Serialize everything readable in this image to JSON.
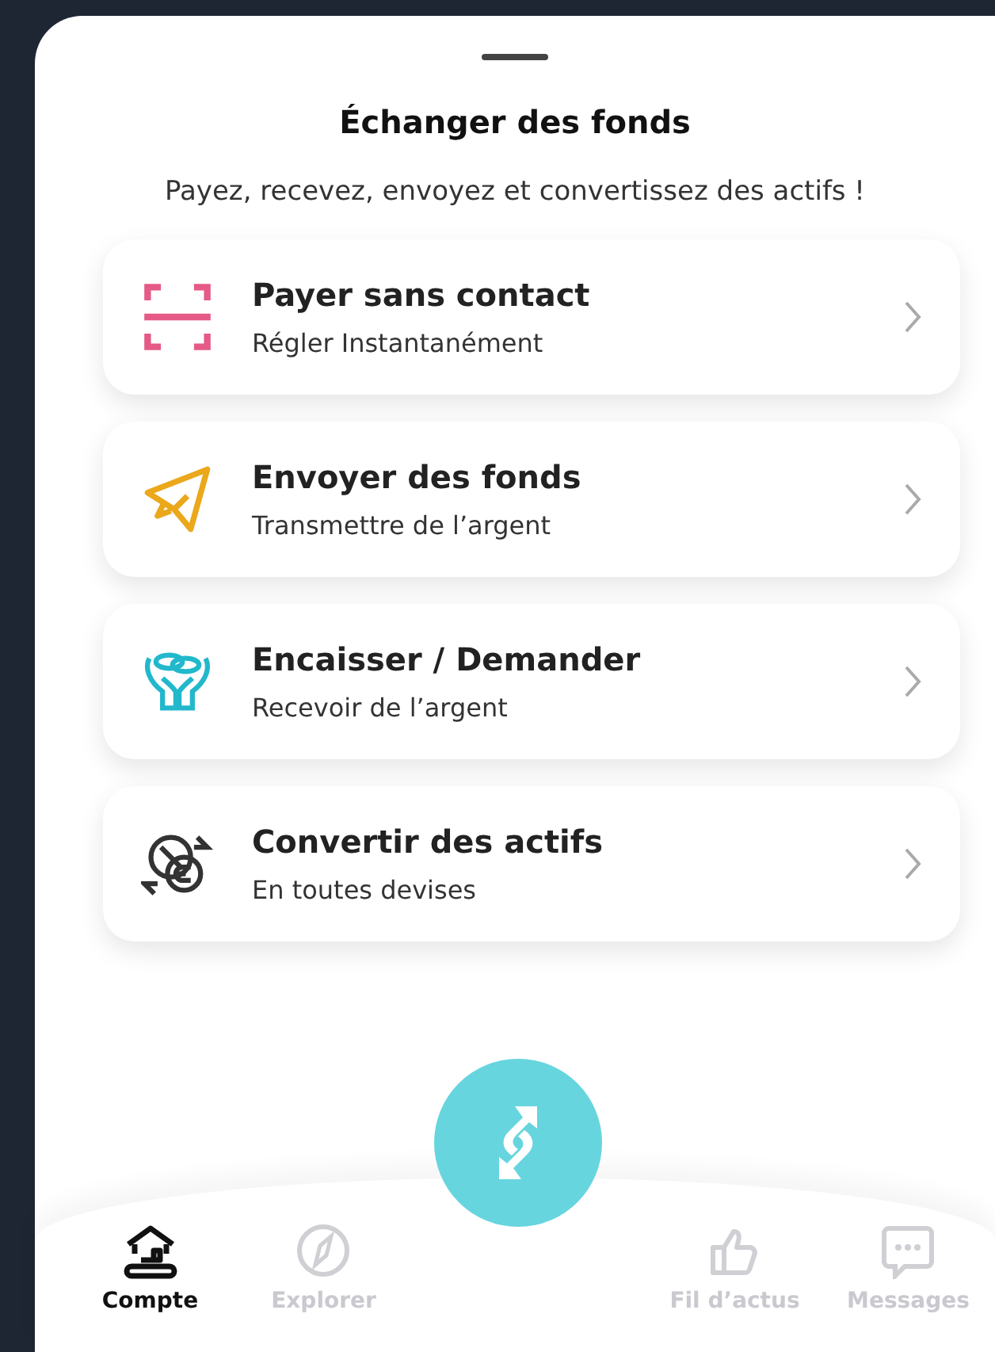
{
  "sheet": {
    "title": "Échanger des fonds",
    "subtitle": "Payez, recevez, envoyez et convertissez des actifs !"
  },
  "actions": [
    {
      "kind": "scan",
      "color": "#e55a86",
      "title": "Payer sans contact",
      "subtitle": "Régler Instantanément"
    },
    {
      "kind": "send",
      "color": "#eaa81a",
      "title": "Envoyer des fonds",
      "subtitle": "Transmettre de l’argent"
    },
    {
      "kind": "receive",
      "color": "#22b8cc",
      "title": "Encaisser / Demander",
      "subtitle": "Recevoir de l’argent"
    },
    {
      "kind": "convert",
      "color": "#333333",
      "title": "Convertir des actifs",
      "subtitle": "En toutes devises"
    }
  ],
  "tab_bar": {
    "items": [
      {
        "kind": "account",
        "label": "Compte",
        "selected": true
      },
      {
        "kind": "explore",
        "label": "Explorer",
        "selected": false
      },
      {
        "kind": "feed",
        "label": "Fil d’actus",
        "selected": false
      },
      {
        "kind": "messages",
        "label": "Messages",
        "selected": false
      }
    ]
  }
}
